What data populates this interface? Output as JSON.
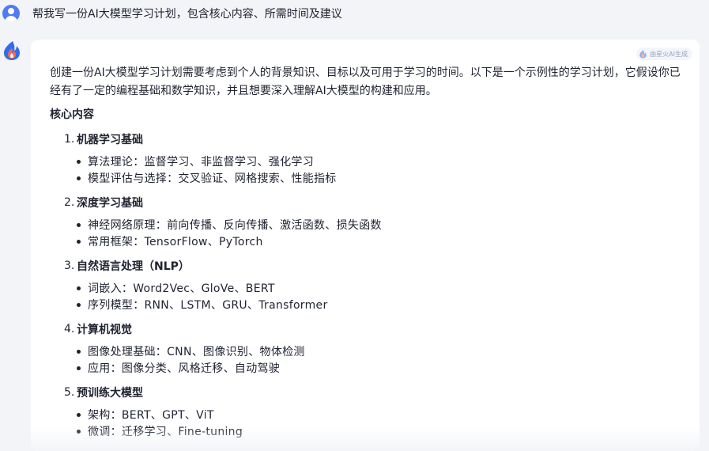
{
  "user_message": {
    "text": "帮我写一份AI大模型学习计划，包含核心内容、所需时间及建议"
  },
  "answer": {
    "badge_label": "由星火AI生成",
    "intro": "创建一份AI大模型学习计划需要考虑到个人的背景知识、目标以及可用于学习的时间。以下是一个示例性的学习计划，它假设你已经有了一定的编程基础和数学知识，并且想要深入理解AI大模型的构建和应用。",
    "section_title": "核心内容",
    "topics": [
      {
        "num": "1.",
        "title": "机器学习基础",
        "items": [
          "算法理论：监督学习、非监督学习、强化学习",
          "模型评估与选择：交叉验证、网格搜索、性能指标"
        ]
      },
      {
        "num": "2.",
        "title": "深度学习基础",
        "items": [
          "神经网络原理：前向传播、反向传播、激活函数、损失函数",
          "常用框架：TensorFlow、PyTorch"
        ]
      },
      {
        "num": "3.",
        "title": "自然语言处理（NLP）",
        "items": [
          "词嵌入：Word2Vec、GloVe、BERT",
          "序列模型：RNN、LSTM、GRU、Transformer"
        ]
      },
      {
        "num": "4.",
        "title": "计算机视觉",
        "items": [
          "图像处理基础：CNN、图像识别、物体检测",
          "应用：图像分类、风格迁移、自动驾驶"
        ]
      },
      {
        "num": "5.",
        "title": "预训练大模型",
        "items": [
          "架构：BERT、GPT、ViT",
          "微调：迁移学习、Fine-tuning"
        ]
      }
    ]
  },
  "icons": {
    "user_avatar": "user-avatar-icon",
    "bot_avatar": "spark-flame-icon",
    "badge": "spark-flame-icon"
  },
  "colors": {
    "background": "#f3f4f8",
    "card": "#ffffff",
    "text": "#1f2330",
    "avatar_blue": "#4e7cf4",
    "badge_text": "#9aa3b4"
  }
}
